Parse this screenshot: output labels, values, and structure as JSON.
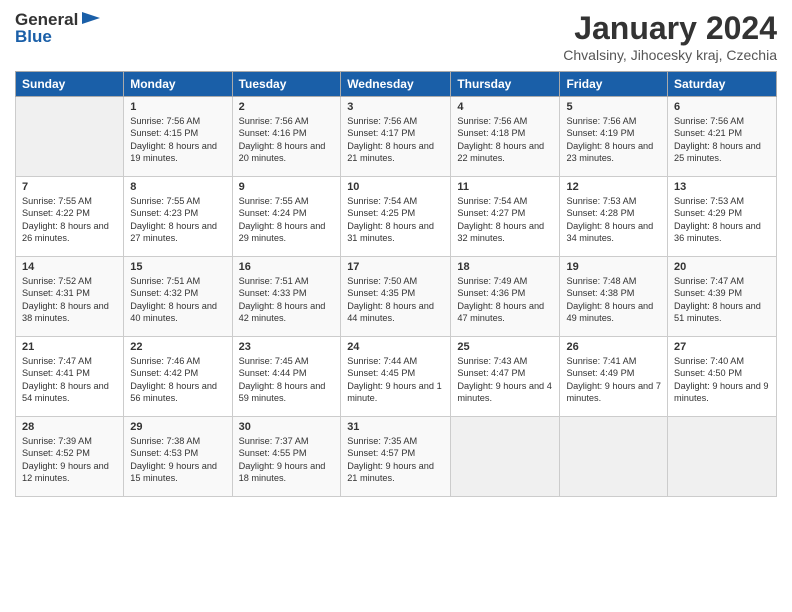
{
  "logo": {
    "general": "General",
    "blue": "Blue"
  },
  "title": "January 2024",
  "subtitle": "Chvalsiny, Jihocesky kraj, Czechia",
  "days_header": [
    "Sunday",
    "Monday",
    "Tuesday",
    "Wednesday",
    "Thursday",
    "Friday",
    "Saturday"
  ],
  "weeks": [
    [
      {
        "num": "",
        "sunrise": "",
        "sunset": "",
        "daylight": ""
      },
      {
        "num": "1",
        "sunrise": "Sunrise: 7:56 AM",
        "sunset": "Sunset: 4:15 PM",
        "daylight": "Daylight: 8 hours and 19 minutes."
      },
      {
        "num": "2",
        "sunrise": "Sunrise: 7:56 AM",
        "sunset": "Sunset: 4:16 PM",
        "daylight": "Daylight: 8 hours and 20 minutes."
      },
      {
        "num": "3",
        "sunrise": "Sunrise: 7:56 AM",
        "sunset": "Sunset: 4:17 PM",
        "daylight": "Daylight: 8 hours and 21 minutes."
      },
      {
        "num": "4",
        "sunrise": "Sunrise: 7:56 AM",
        "sunset": "Sunset: 4:18 PM",
        "daylight": "Daylight: 8 hours and 22 minutes."
      },
      {
        "num": "5",
        "sunrise": "Sunrise: 7:56 AM",
        "sunset": "Sunset: 4:19 PM",
        "daylight": "Daylight: 8 hours and 23 minutes."
      },
      {
        "num": "6",
        "sunrise": "Sunrise: 7:56 AM",
        "sunset": "Sunset: 4:21 PM",
        "daylight": "Daylight: 8 hours and 25 minutes."
      }
    ],
    [
      {
        "num": "7",
        "sunrise": "Sunrise: 7:55 AM",
        "sunset": "Sunset: 4:22 PM",
        "daylight": "Daylight: 8 hours and 26 minutes."
      },
      {
        "num": "8",
        "sunrise": "Sunrise: 7:55 AM",
        "sunset": "Sunset: 4:23 PM",
        "daylight": "Daylight: 8 hours and 27 minutes."
      },
      {
        "num": "9",
        "sunrise": "Sunrise: 7:55 AM",
        "sunset": "Sunset: 4:24 PM",
        "daylight": "Daylight: 8 hours and 29 minutes."
      },
      {
        "num": "10",
        "sunrise": "Sunrise: 7:54 AM",
        "sunset": "Sunset: 4:25 PM",
        "daylight": "Daylight: 8 hours and 31 minutes."
      },
      {
        "num": "11",
        "sunrise": "Sunrise: 7:54 AM",
        "sunset": "Sunset: 4:27 PM",
        "daylight": "Daylight: 8 hours and 32 minutes."
      },
      {
        "num": "12",
        "sunrise": "Sunrise: 7:53 AM",
        "sunset": "Sunset: 4:28 PM",
        "daylight": "Daylight: 8 hours and 34 minutes."
      },
      {
        "num": "13",
        "sunrise": "Sunrise: 7:53 AM",
        "sunset": "Sunset: 4:29 PM",
        "daylight": "Daylight: 8 hours and 36 minutes."
      }
    ],
    [
      {
        "num": "14",
        "sunrise": "Sunrise: 7:52 AM",
        "sunset": "Sunset: 4:31 PM",
        "daylight": "Daylight: 8 hours and 38 minutes."
      },
      {
        "num": "15",
        "sunrise": "Sunrise: 7:51 AM",
        "sunset": "Sunset: 4:32 PM",
        "daylight": "Daylight: 8 hours and 40 minutes."
      },
      {
        "num": "16",
        "sunrise": "Sunrise: 7:51 AM",
        "sunset": "Sunset: 4:33 PM",
        "daylight": "Daylight: 8 hours and 42 minutes."
      },
      {
        "num": "17",
        "sunrise": "Sunrise: 7:50 AM",
        "sunset": "Sunset: 4:35 PM",
        "daylight": "Daylight: 8 hours and 44 minutes."
      },
      {
        "num": "18",
        "sunrise": "Sunrise: 7:49 AM",
        "sunset": "Sunset: 4:36 PM",
        "daylight": "Daylight: 8 hours and 47 minutes."
      },
      {
        "num": "19",
        "sunrise": "Sunrise: 7:48 AM",
        "sunset": "Sunset: 4:38 PM",
        "daylight": "Daylight: 8 hours and 49 minutes."
      },
      {
        "num": "20",
        "sunrise": "Sunrise: 7:47 AM",
        "sunset": "Sunset: 4:39 PM",
        "daylight": "Daylight: 8 hours and 51 minutes."
      }
    ],
    [
      {
        "num": "21",
        "sunrise": "Sunrise: 7:47 AM",
        "sunset": "Sunset: 4:41 PM",
        "daylight": "Daylight: 8 hours and 54 minutes."
      },
      {
        "num": "22",
        "sunrise": "Sunrise: 7:46 AM",
        "sunset": "Sunset: 4:42 PM",
        "daylight": "Daylight: 8 hours and 56 minutes."
      },
      {
        "num": "23",
        "sunrise": "Sunrise: 7:45 AM",
        "sunset": "Sunset: 4:44 PM",
        "daylight": "Daylight: 8 hours and 59 minutes."
      },
      {
        "num": "24",
        "sunrise": "Sunrise: 7:44 AM",
        "sunset": "Sunset: 4:45 PM",
        "daylight": "Daylight: 9 hours and 1 minute."
      },
      {
        "num": "25",
        "sunrise": "Sunrise: 7:43 AM",
        "sunset": "Sunset: 4:47 PM",
        "daylight": "Daylight: 9 hours and 4 minutes."
      },
      {
        "num": "26",
        "sunrise": "Sunrise: 7:41 AM",
        "sunset": "Sunset: 4:49 PM",
        "daylight": "Daylight: 9 hours and 7 minutes."
      },
      {
        "num": "27",
        "sunrise": "Sunrise: 7:40 AM",
        "sunset": "Sunset: 4:50 PM",
        "daylight": "Daylight: 9 hours and 9 minutes."
      }
    ],
    [
      {
        "num": "28",
        "sunrise": "Sunrise: 7:39 AM",
        "sunset": "Sunset: 4:52 PM",
        "daylight": "Daylight: 9 hours and 12 minutes."
      },
      {
        "num": "29",
        "sunrise": "Sunrise: 7:38 AM",
        "sunset": "Sunset: 4:53 PM",
        "daylight": "Daylight: 9 hours and 15 minutes."
      },
      {
        "num": "30",
        "sunrise": "Sunrise: 7:37 AM",
        "sunset": "Sunset: 4:55 PM",
        "daylight": "Daylight: 9 hours and 18 minutes."
      },
      {
        "num": "31",
        "sunrise": "Sunrise: 7:35 AM",
        "sunset": "Sunset: 4:57 PM",
        "daylight": "Daylight: 9 hours and 21 minutes."
      },
      {
        "num": "",
        "sunrise": "",
        "sunset": "",
        "daylight": ""
      },
      {
        "num": "",
        "sunrise": "",
        "sunset": "",
        "daylight": ""
      },
      {
        "num": "",
        "sunrise": "",
        "sunset": "",
        "daylight": ""
      }
    ]
  ]
}
